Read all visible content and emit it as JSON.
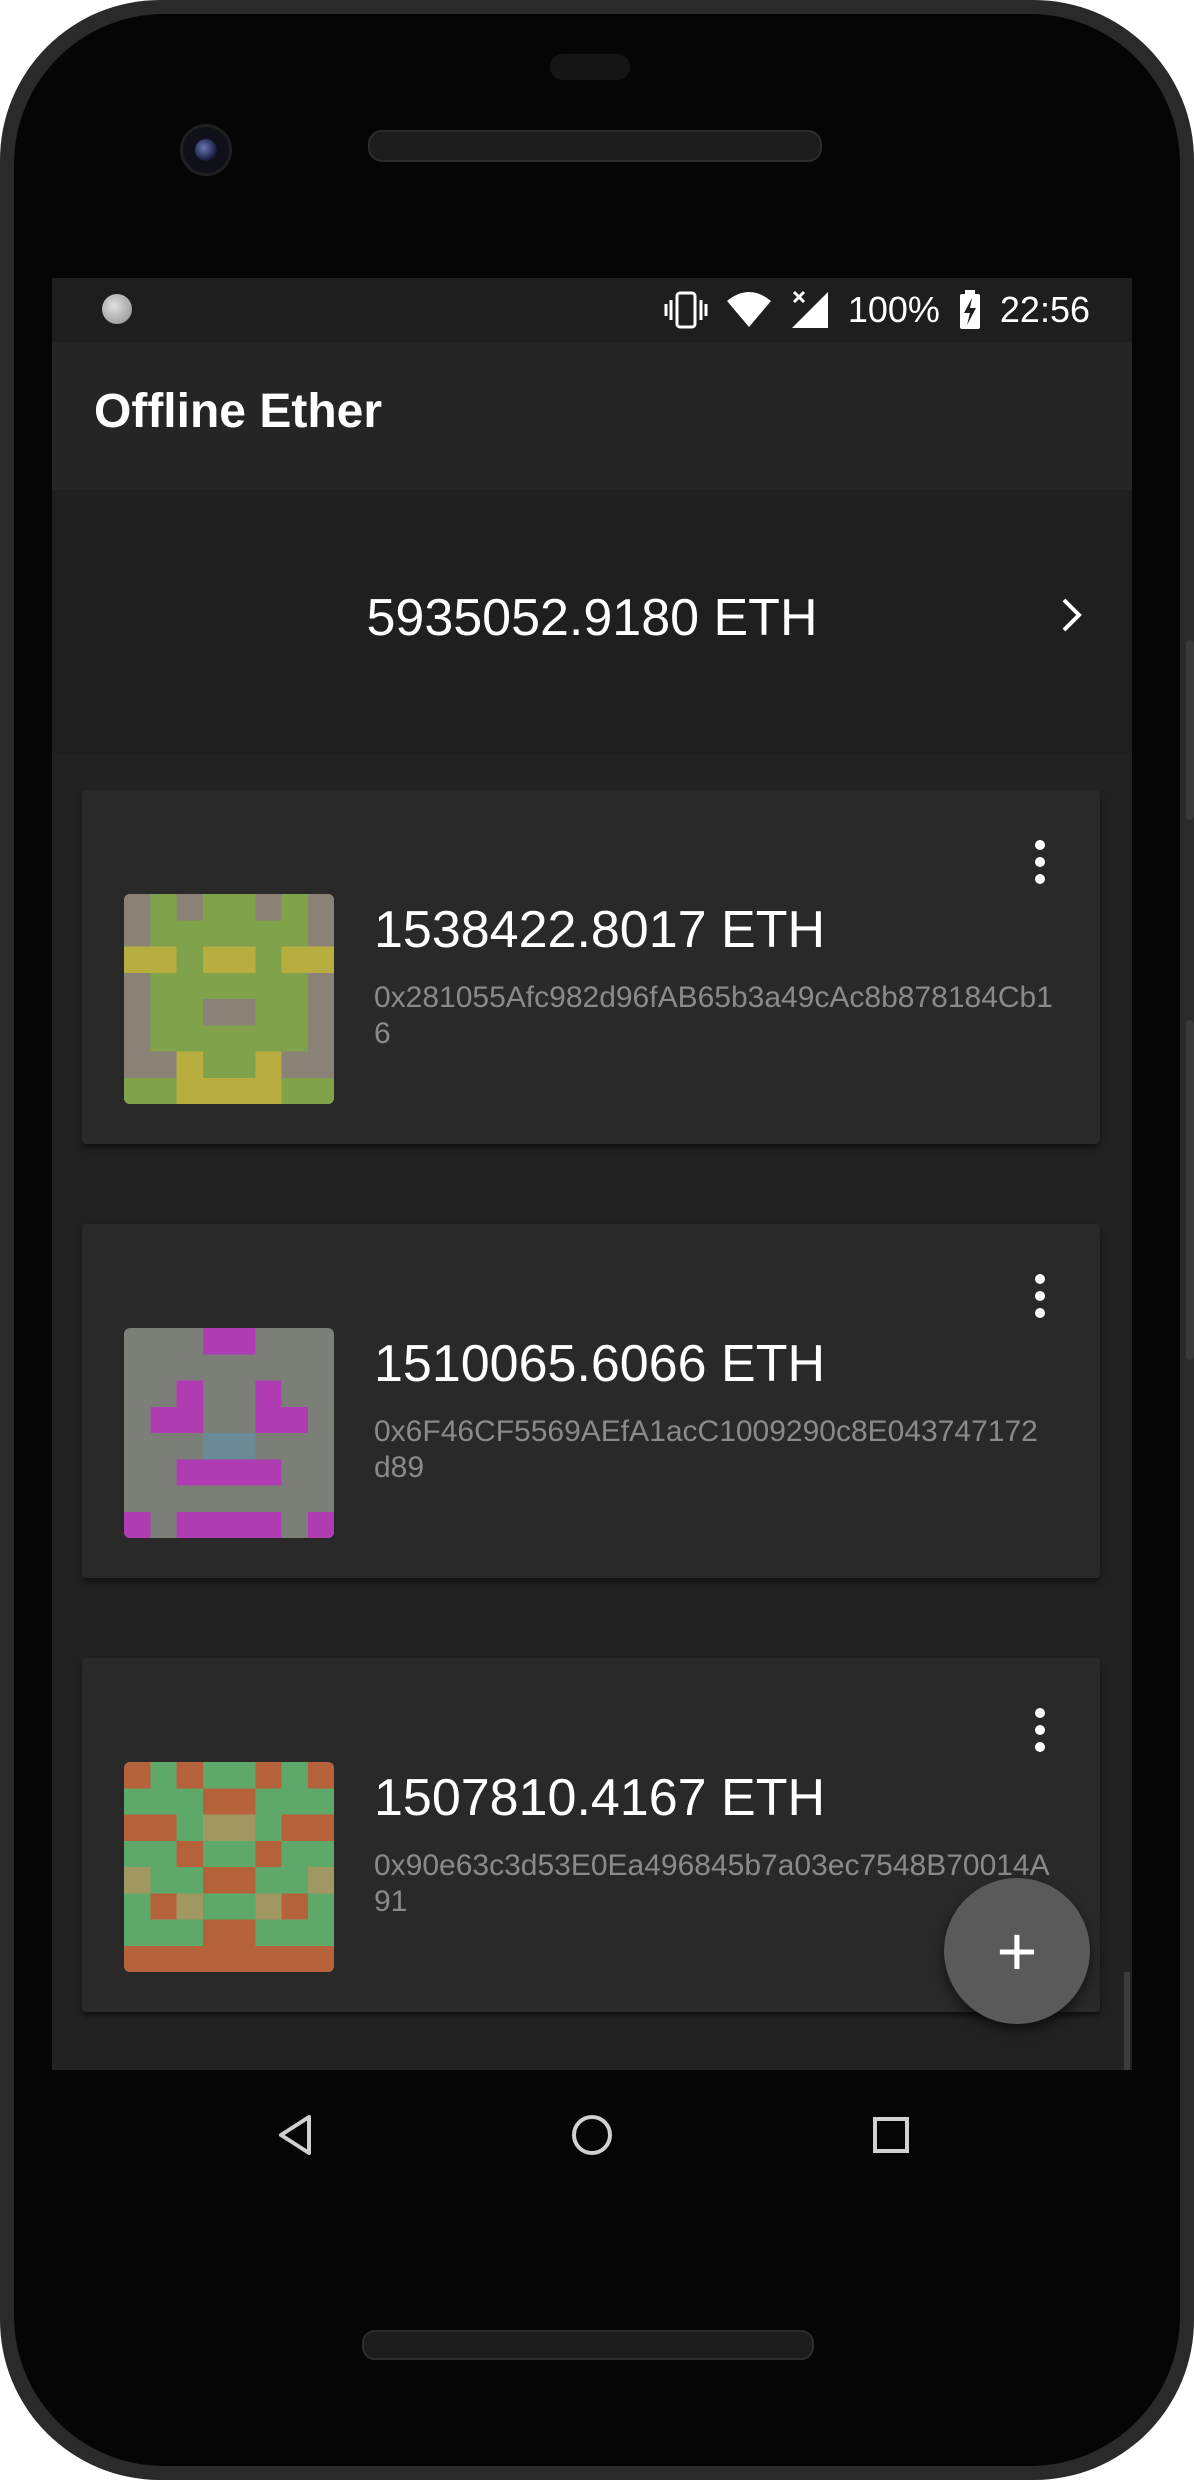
{
  "status_bar": {
    "battery": "100%",
    "time": "22:56",
    "icons": [
      "notification-dot-icon",
      "vibrate-icon",
      "wifi-icon",
      "cell-signal-off-icon",
      "battery-charging-icon"
    ]
  },
  "app_bar": {
    "title": "Offline Ether"
  },
  "total": {
    "amount": "5935052.9180 ETH",
    "icon": "chevron-right-icon"
  },
  "wallets": [
    {
      "amount": "1538422.8017 ETH",
      "address": "0x281055Afc982d96fAB65b3a49cAc8b878184Cb16"
    },
    {
      "amount": "1510065.6066 ETH",
      "address": "0x6F46CF5569AEfA1acC1009290c8E043747172d89"
    },
    {
      "amount": "1507810.4167 ETH",
      "address": "0x90e63c3d53E0Ea496845b7a03ec7548B70014A91"
    }
  ],
  "fab": {
    "label": "+"
  },
  "nav": {
    "icons": [
      "back-icon",
      "home-icon",
      "recents-icon"
    ]
  },
  "colors": {
    "background": "#1f1f1f",
    "card": "#292929",
    "avatar1": [
      "#7fa24a",
      "#8a8276",
      "#b8ae40"
    ],
    "avatar2": [
      "#7c7f78",
      "#b03cb4",
      "#6a8a96"
    ],
    "avatar3": [
      "#b5623a",
      "#5ea86a",
      "#a09860"
    ]
  }
}
